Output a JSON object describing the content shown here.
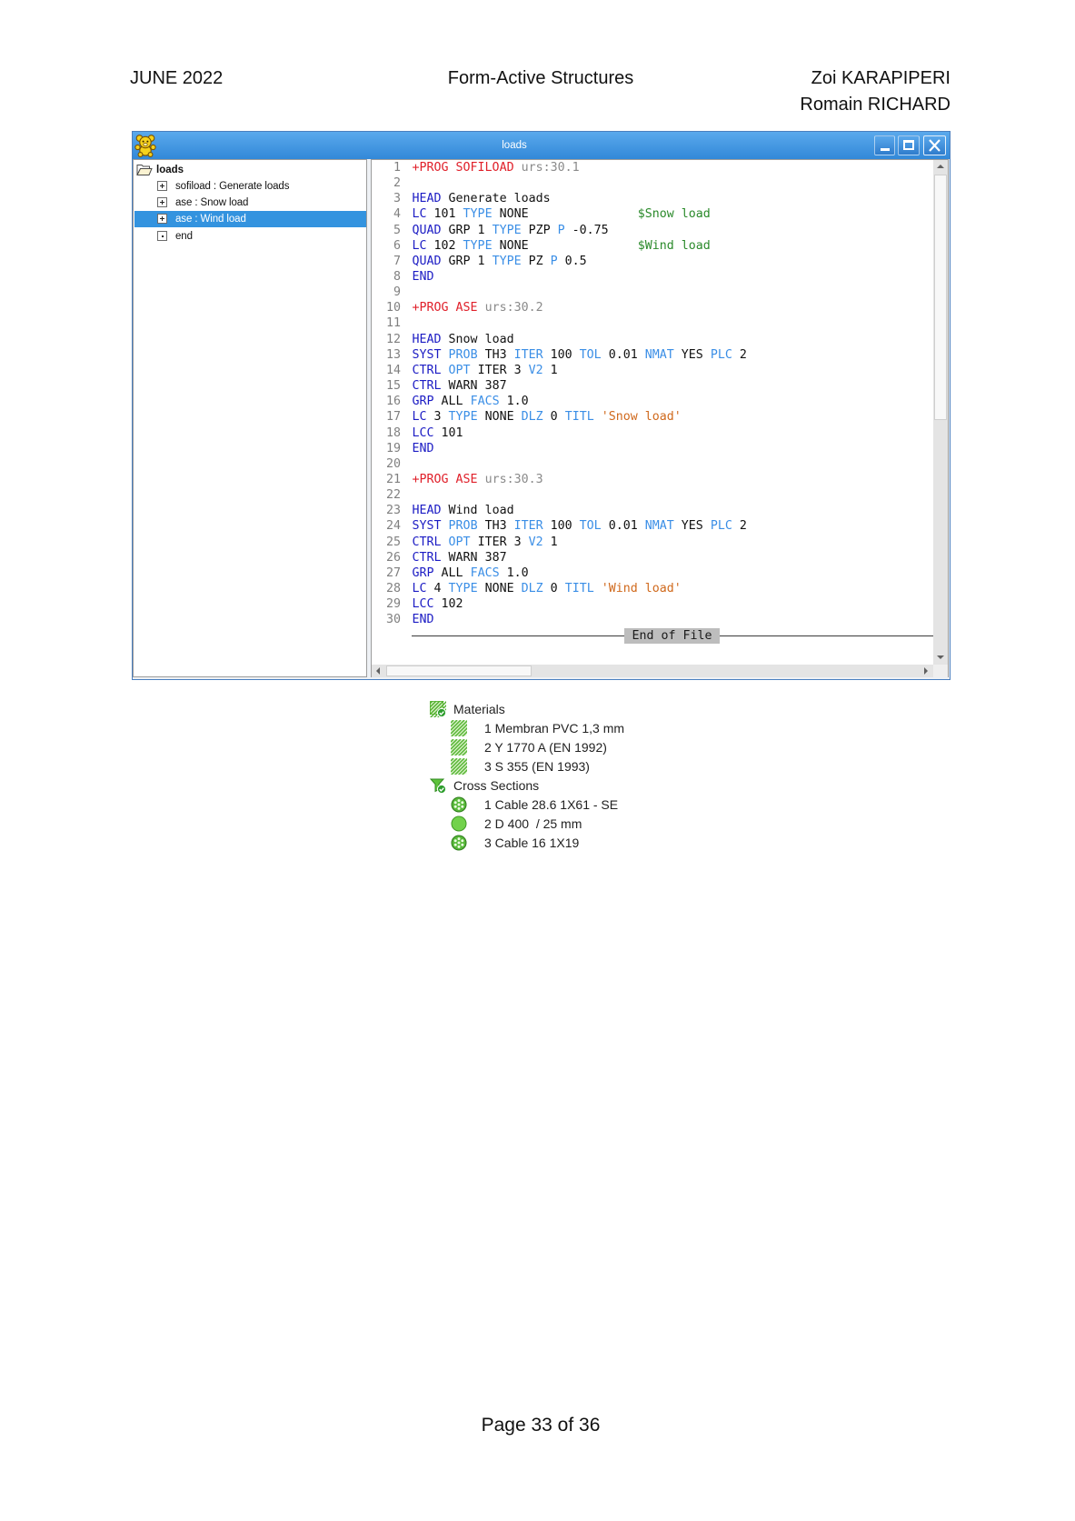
{
  "header": {
    "date": "JUNE 2022",
    "title": "Form-Active Structures",
    "authors": [
      "Zoi KARAPIPERI",
      "Romain RICHARD"
    ]
  },
  "window": {
    "title": "loads",
    "app_icon": "teddy-bear-icon",
    "controls": [
      "minimize-icon",
      "maximize-icon",
      "close-icon"
    ],
    "tree": {
      "root": {
        "label": "loads",
        "icon": "folder-open-icon"
      },
      "items": [
        {
          "label": "sofiload : Generate loads",
          "icon": "expand-icon",
          "selected": false
        },
        {
          "label": "ase : Snow load",
          "icon": "expand-icon",
          "selected": false
        },
        {
          "label": "ase : Wind load",
          "icon": "expand-icon",
          "selected": true
        },
        {
          "label": "end",
          "icon": "leaf-node-icon",
          "selected": false
        }
      ]
    },
    "editor": {
      "lines": [
        {
          "n": "1",
          "tokens": [
            [
              "+PROG SOFILOAD",
              "prog"
            ],
            [
              " ",
              "plain"
            ],
            [
              "urs:30.1",
              "urs"
            ]
          ]
        },
        {
          "n": "2",
          "tokens": []
        },
        {
          "n": "3",
          "tokens": [
            [
              "HEAD",
              "keyword"
            ],
            [
              " Generate loads",
              "plain"
            ]
          ]
        },
        {
          "n": "4",
          "tokens": [
            [
              "LC",
              "keyword"
            ],
            [
              " 101 ",
              "plain"
            ],
            [
              "TYPE",
              "option"
            ],
            [
              " NONE               ",
              "plain"
            ],
            [
              "$Snow load",
              "comment"
            ]
          ]
        },
        {
          "n": "5",
          "tokens": [
            [
              "QUAD",
              "keyword"
            ],
            [
              " GRP 1 ",
              "plain"
            ],
            [
              "TYPE",
              "option"
            ],
            [
              " PZP ",
              "plain"
            ],
            [
              "P",
              "option"
            ],
            [
              " -0.75",
              "plain"
            ]
          ]
        },
        {
          "n": "6",
          "tokens": [
            [
              "LC",
              "keyword"
            ],
            [
              " 102 ",
              "plain"
            ],
            [
              "TYPE",
              "option"
            ],
            [
              " NONE               ",
              "plain"
            ],
            [
              "$Wind load",
              "comment"
            ]
          ]
        },
        {
          "n": "7",
          "tokens": [
            [
              "QUAD",
              "keyword"
            ],
            [
              " GRP 1 ",
              "plain"
            ],
            [
              "TYPE",
              "option"
            ],
            [
              " PZ ",
              "plain"
            ],
            [
              "P",
              "option"
            ],
            [
              " 0.5",
              "plain"
            ]
          ]
        },
        {
          "n": "8",
          "tokens": [
            [
              "END",
              "keyword"
            ]
          ]
        },
        {
          "n": "9",
          "tokens": []
        },
        {
          "n": "10",
          "tokens": [
            [
              "+PROG ASE",
              "prog"
            ],
            [
              " ",
              "plain"
            ],
            [
              "urs:30.2",
              "urs"
            ]
          ]
        },
        {
          "n": "11",
          "tokens": []
        },
        {
          "n": "12",
          "tokens": [
            [
              "HEAD",
              "keyword"
            ],
            [
              " Snow load",
              "plain"
            ]
          ]
        },
        {
          "n": "13",
          "tokens": [
            [
              "SYST",
              "keyword"
            ],
            [
              " ",
              "plain"
            ],
            [
              "PROB",
              "option"
            ],
            [
              " TH3 ",
              "plain"
            ],
            [
              "ITER",
              "option"
            ],
            [
              " 100 ",
              "plain"
            ],
            [
              "TOL",
              "option"
            ],
            [
              " 0.01 ",
              "plain"
            ],
            [
              "NMAT",
              "option"
            ],
            [
              " YES ",
              "plain"
            ],
            [
              "PLC",
              "option"
            ],
            [
              " 2",
              "plain"
            ]
          ]
        },
        {
          "n": "14",
          "tokens": [
            [
              "CTRL",
              "keyword"
            ],
            [
              " ",
              "plain"
            ],
            [
              "OPT",
              "option"
            ],
            [
              " ITER 3 ",
              "plain"
            ],
            [
              "V2",
              "option"
            ],
            [
              " 1",
              "plain"
            ]
          ]
        },
        {
          "n": "15",
          "tokens": [
            [
              "CTRL",
              "keyword"
            ],
            [
              " WARN 387",
              "plain"
            ]
          ]
        },
        {
          "n": "16",
          "tokens": [
            [
              "GRP",
              "keyword"
            ],
            [
              " ALL ",
              "plain"
            ],
            [
              "FACS",
              "option"
            ],
            [
              " 1.0",
              "plain"
            ]
          ]
        },
        {
          "n": "17",
          "tokens": [
            [
              "LC",
              "keyword"
            ],
            [
              " 3 ",
              "plain"
            ],
            [
              "TYPE",
              "option"
            ],
            [
              " NONE ",
              "plain"
            ],
            [
              "DLZ",
              "option"
            ],
            [
              " 0 ",
              "plain"
            ],
            [
              "TITL",
              "option"
            ],
            [
              " ",
              "plain"
            ],
            [
              "'Snow load'",
              "string"
            ]
          ]
        },
        {
          "n": "18",
          "tokens": [
            [
              "LCC",
              "keyword"
            ],
            [
              " 101",
              "plain"
            ]
          ]
        },
        {
          "n": "19",
          "tokens": [
            [
              "END",
              "keyword"
            ]
          ]
        },
        {
          "n": "20",
          "tokens": []
        },
        {
          "n": "21",
          "tokens": [
            [
              "+PROG ASE",
              "prog"
            ],
            [
              " ",
              "plain"
            ],
            [
              "urs:30.3",
              "urs"
            ]
          ]
        },
        {
          "n": "22",
          "tokens": []
        },
        {
          "n": "23",
          "tokens": [
            [
              "HEAD",
              "keyword"
            ],
            [
              " Wind load",
              "plain"
            ]
          ]
        },
        {
          "n": "24",
          "tokens": [
            [
              "SYST",
              "keyword"
            ],
            [
              " ",
              "plain"
            ],
            [
              "PROB",
              "option"
            ],
            [
              " TH3 ",
              "plain"
            ],
            [
              "ITER",
              "option"
            ],
            [
              " 100 ",
              "plain"
            ],
            [
              "TOL",
              "option"
            ],
            [
              " 0.01 ",
              "plain"
            ],
            [
              "NMAT",
              "option"
            ],
            [
              " YES ",
              "plain"
            ],
            [
              "PLC",
              "option"
            ],
            [
              " 2",
              "plain"
            ]
          ]
        },
        {
          "n": "25",
          "tokens": [
            [
              "CTRL",
              "keyword"
            ],
            [
              " ",
              "plain"
            ],
            [
              "OPT",
              "option"
            ],
            [
              " ITER 3 ",
              "plain"
            ],
            [
              "V2",
              "option"
            ],
            [
              " 1",
              "plain"
            ]
          ]
        },
        {
          "n": "26",
          "tokens": [
            [
              "CTRL",
              "keyword"
            ],
            [
              " WARN 387",
              "plain"
            ]
          ]
        },
        {
          "n": "27",
          "tokens": [
            [
              "GRP",
              "keyword"
            ],
            [
              " ALL ",
              "plain"
            ],
            [
              "FACS",
              "option"
            ],
            [
              " 1.0",
              "plain"
            ]
          ]
        },
        {
          "n": "28",
          "tokens": [
            [
              "LC",
              "keyword"
            ],
            [
              " 4 ",
              "plain"
            ],
            [
              "TYPE",
              "option"
            ],
            [
              " NONE ",
              "plain"
            ],
            [
              "DLZ",
              "option"
            ],
            [
              " 0 ",
              "plain"
            ],
            [
              "TITL",
              "option"
            ],
            [
              " ",
              "plain"
            ],
            [
              "'Wind load'",
              "string"
            ]
          ]
        },
        {
          "n": "29",
          "tokens": [
            [
              "LCC",
              "keyword"
            ],
            [
              " 102",
              "plain"
            ]
          ]
        },
        {
          "n": "30",
          "tokens": [
            [
              "END",
              "keyword"
            ]
          ]
        }
      ],
      "end_marker": "End of File"
    }
  },
  "colors": {
    "title_bar": "#3288d8",
    "selection": "#3393df",
    "syntax": {
      "prog": "#e0202a",
      "urs": "#8a8a8a",
      "keyword": "#1c1cc4",
      "option": "#3a8ee6",
      "comment": "#2b8a2b",
      "string": "#d0691c",
      "plain": "#111111"
    }
  },
  "model_tree": [
    {
      "label": "Materials",
      "icon": "materials-icon",
      "items": [
        {
          "label": "1 Membran PVC 1,3 mm",
          "icon": "material-hatch-icon"
        },
        {
          "label": "2 Y 1770 A (EN 1992)",
          "icon": "material-hatch-icon"
        },
        {
          "label": "3 S 355 (EN 1993)",
          "icon": "material-hatch-icon"
        }
      ]
    },
    {
      "label": "Cross Sections",
      "icon": "cross-sections-icon",
      "items": [
        {
          "label": "1 Cable 28.6 1X61 - SE",
          "icon": "cable-section-icon"
        },
        {
          "label": "2 D 400  / 25 mm",
          "icon": "solid-section-icon"
        },
        {
          "label": "3 Cable 16 1X19",
          "icon": "cable-section-icon"
        }
      ]
    }
  ],
  "footer": {
    "page": "Page 33 of 36"
  }
}
